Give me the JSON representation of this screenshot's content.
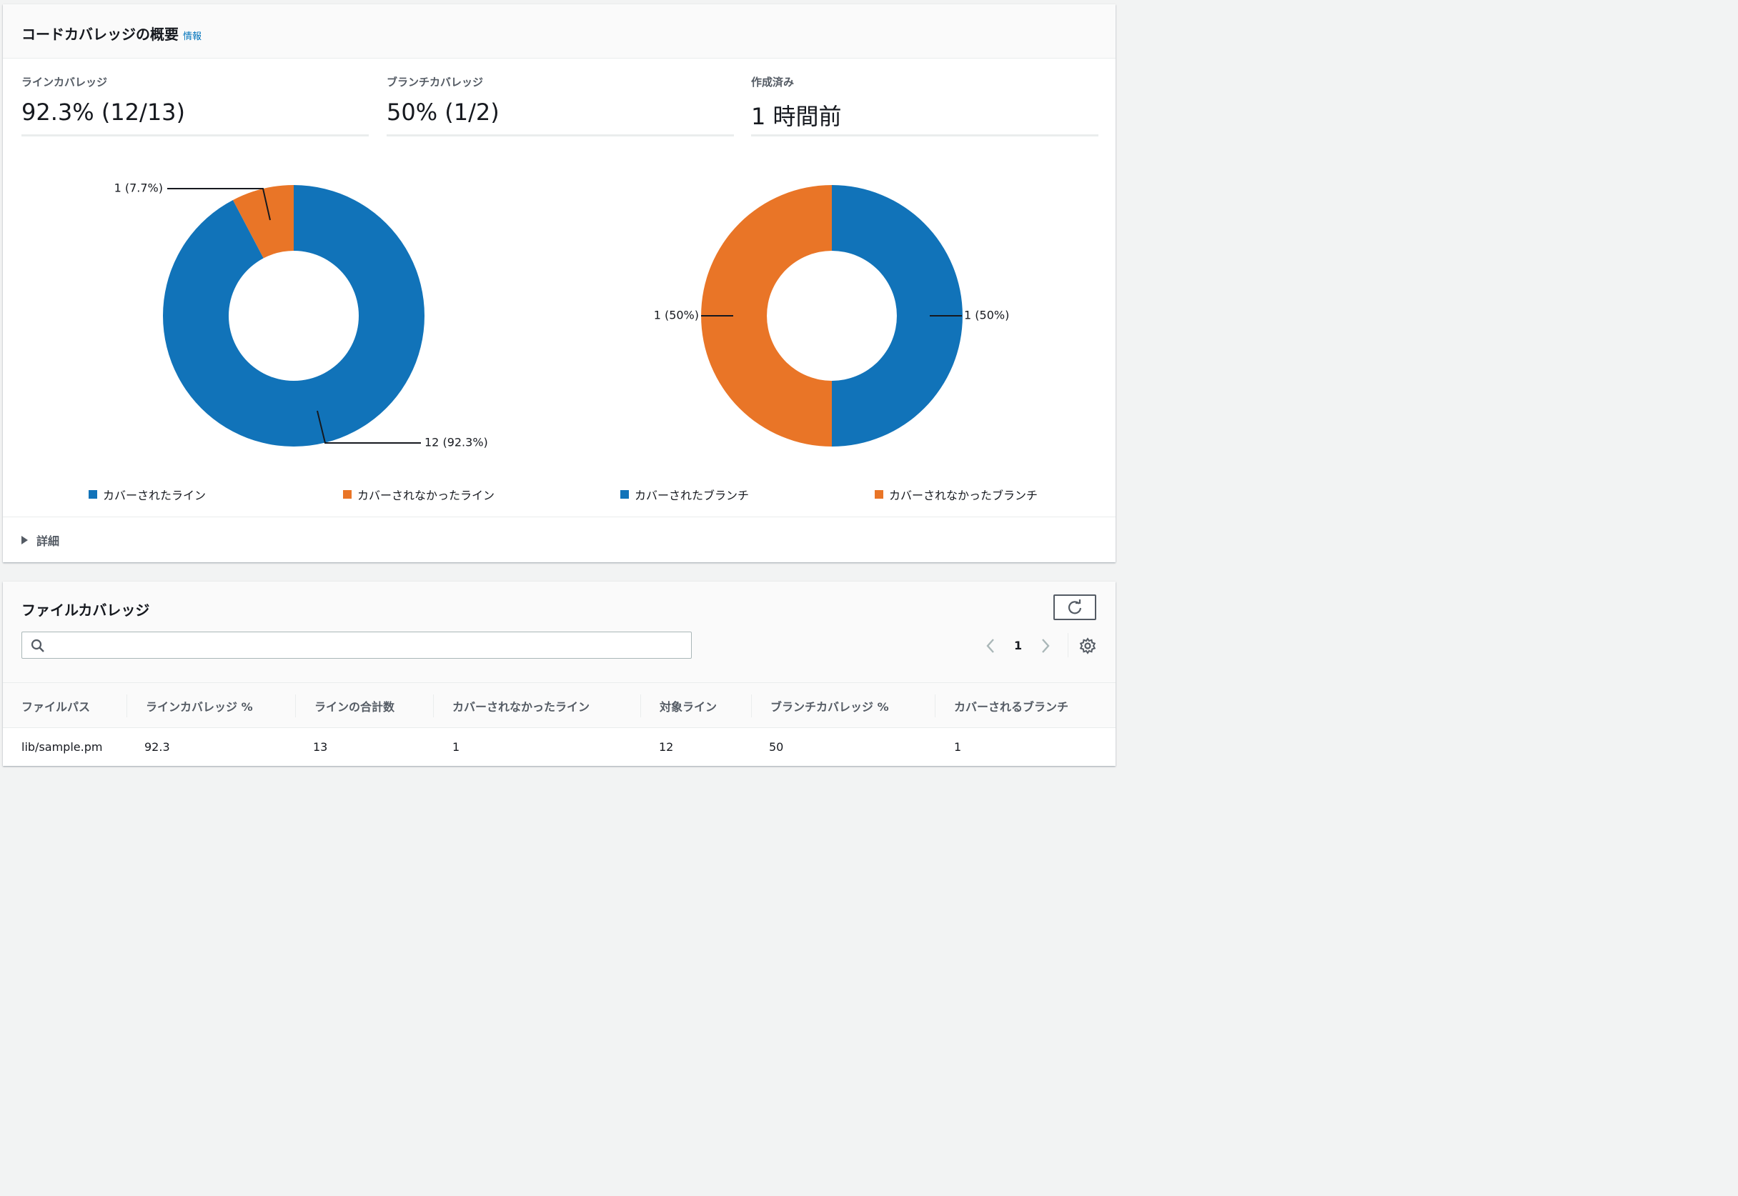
{
  "summary": {
    "title": "コードカバレッジの概要",
    "info": "情報",
    "metrics": [
      {
        "label": "ラインカバレッジ",
        "value": "92.3% (12/13)"
      },
      {
        "label": "ブランチカバレッジ",
        "value": "50% (1/2)"
      },
      {
        "label": "作成済み",
        "value": "1 時間前"
      }
    ],
    "details": "詳細"
  },
  "colors": {
    "covered": "#1173b9",
    "uncovered": "#e97527"
  },
  "chart_data": [
    {
      "type": "pie",
      "variant": "donut",
      "labels": [
        "カバーされたライン",
        "カバーされなかったライン"
      ],
      "values": [
        12,
        1
      ],
      "percents": [
        92.3,
        7.7
      ],
      "data_labels": [
        "12 (92.3%)",
        "1 (7.7%)"
      ],
      "colors": [
        "#1173b9",
        "#e97527"
      ],
      "legend_position": "bottom"
    },
    {
      "type": "pie",
      "variant": "donut",
      "labels": [
        "カバーされたブランチ",
        "カバーされなかったブランチ"
      ],
      "values": [
        1,
        1
      ],
      "percents": [
        50,
        50
      ],
      "data_labels": [
        "1 (50%)",
        "1 (50%)"
      ],
      "colors": [
        "#1173b9",
        "#e97527"
      ],
      "legend_position": "bottom"
    }
  ],
  "files": {
    "title": "ファイルカバレッジ",
    "search_placeholder": "",
    "page": "1",
    "columns": [
      "ファイルパス",
      "ラインカバレッジ %",
      "ラインの合計数",
      "カバーされなかったライン",
      "対象ライン",
      "ブランチカバレッジ %",
      "カバーされるブランチ"
    ],
    "rows": [
      [
        "lib/sample.pm",
        "92.3",
        "13",
        "1",
        "12",
        "50",
        "1"
      ]
    ]
  }
}
